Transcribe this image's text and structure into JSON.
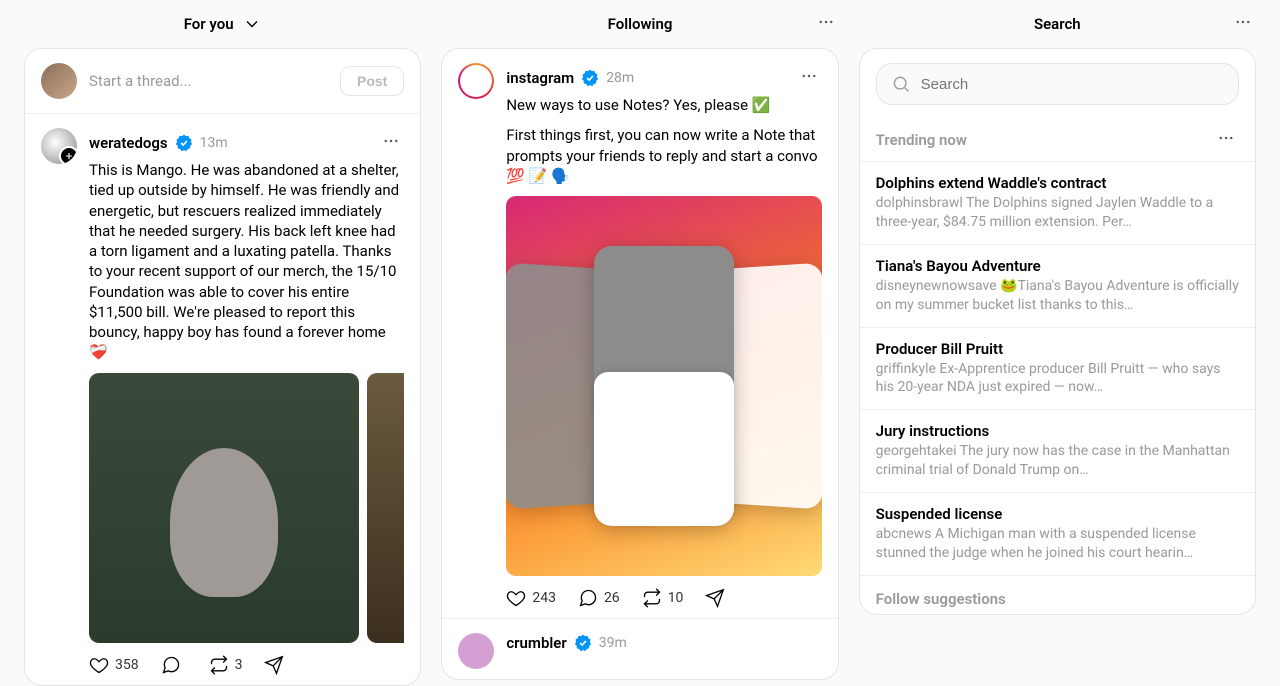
{
  "columns": {
    "for_you": {
      "title": "For you"
    },
    "following": {
      "title": "Following"
    },
    "search": {
      "title": "Search"
    }
  },
  "composer": {
    "placeholder": "Start a thread...",
    "post_label": "Post"
  },
  "feed_for_you": [
    {
      "user": "weratedogs",
      "verified": true,
      "time": "13m",
      "text": "This is Mango. He was abandoned at a shelter, tied up outside by himself. He was friendly and energetic, but rescuers realized immediately that he needed surgery. His back left knee had a torn ligament and a luxating patella. Thanks to your recent support of our merch, the 15/10 Foundation was able to cover his entire $11,500 bill. We're pleased to report this bouncy, happy boy has found a forever home ❤️‍🩹",
      "likes": "358",
      "replies": "",
      "reposts": "3"
    }
  ],
  "feed_following": [
    {
      "user": "instagram",
      "verified": true,
      "time": "28m",
      "text_line1": "New ways to use Notes? Yes, please ✅",
      "text_line2": "First things first, you can now write a Note that prompts your friends to reply and start a convo 💯 📝 🗣️",
      "likes": "243",
      "replies": "26",
      "reposts": "10"
    },
    {
      "user": "crumbler",
      "verified": true,
      "time": "39m"
    }
  ],
  "search": {
    "placeholder": "Search",
    "trending_title": "Trending now",
    "follow_title": "Follow suggestions",
    "trends": [
      {
        "title": "Dolphins extend Waddle's contract",
        "source": "dolphinsbrawl",
        "desc": "The Dolphins signed Jaylen Waddle to a three-year, $84.75 million extension. Per…"
      },
      {
        "title": "Tiana's Bayou Adventure",
        "source": "disneynewnowsave",
        "desc": "🐸Tiana's Bayou Adventure is officially on my summer bucket list thanks to this…"
      },
      {
        "title": "Producer Bill Pruitt",
        "source": "griffinkyle",
        "desc": "Ex-Apprentice producer Bill Pruitt — who says his 20-year NDA just expired — now…"
      },
      {
        "title": "Jury instructions",
        "source": "georgehtakei",
        "desc": "The jury now has the case in the Manhattan criminal trial of Donald Trump on…"
      },
      {
        "title": "Suspended license",
        "source": "abcnews",
        "desc": "A Michigan man with a suspended license stunned the judge when he joined his court hearin…"
      }
    ]
  }
}
